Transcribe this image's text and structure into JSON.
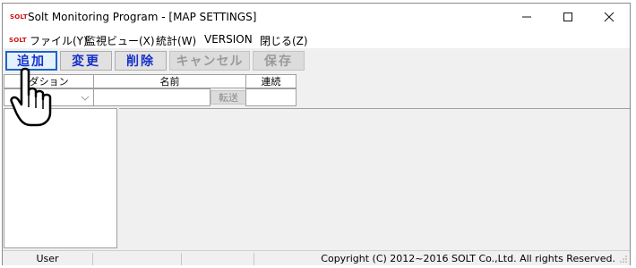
{
  "window": {
    "logo": "SOLT",
    "title": "Solt Monitoring Program - [MAP SETTINGS]",
    "controls": {
      "minimize": "—",
      "maximize": "☐",
      "close": "✕"
    }
  },
  "menu": {
    "logo": "SOLT",
    "items": [
      "ファイル(Y)",
      "監視ビュー(X)",
      "統計(W)",
      "VERSION",
      "閉じる(Z)"
    ]
  },
  "toolbar": {
    "add": "追加",
    "change": "変更",
    "delete": "削除",
    "cancel": "キャンセル",
    "save": "保存"
  },
  "grid": {
    "headers": {
      "option": "ダション",
      "name": "名前",
      "continuous": "連続"
    },
    "send_button": "転送"
  },
  "status": {
    "user": "User",
    "copyright": "Copyright (C) 2012~2016 SOLT Co.,Ltd. All rights Reserved."
  },
  "colors": {
    "button_text": "#1530c8",
    "logo": "#cc1111"
  },
  "icons": {
    "cursor": "hand-pointer-icon"
  }
}
